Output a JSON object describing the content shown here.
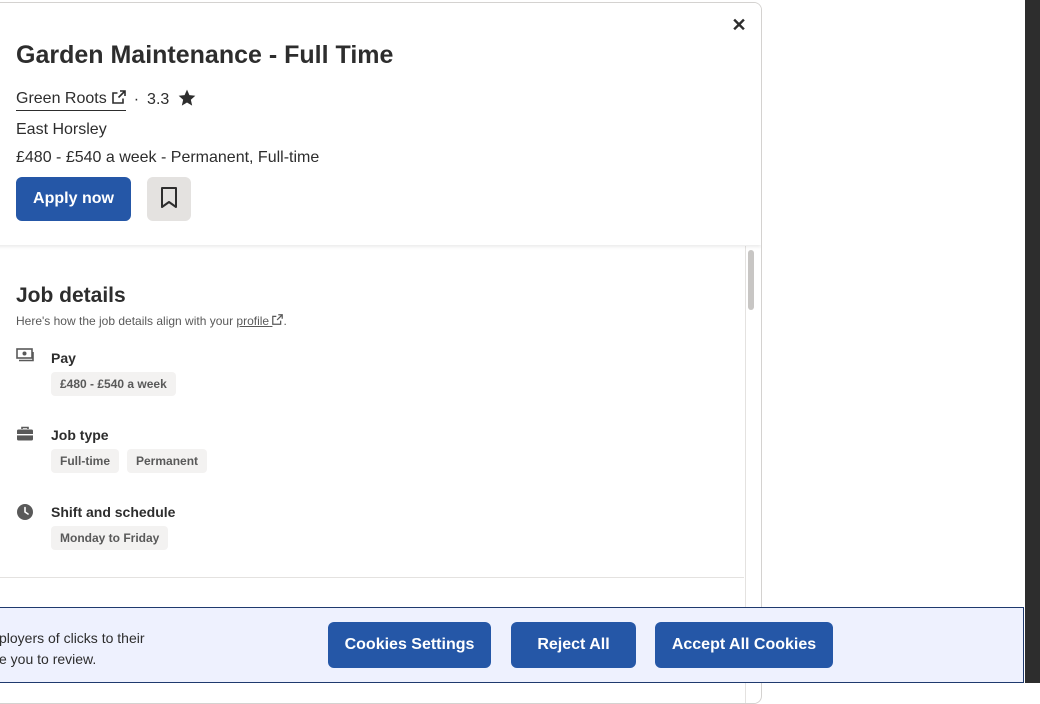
{
  "job": {
    "title": "Garden Maintenance - Full Time",
    "company": "Green Roots",
    "separator": "·",
    "rating": "3.3",
    "location": "East Horsley",
    "salary_line": "£480 - £540 a week  - Permanent, Full-time",
    "apply_label": "Apply now",
    "close_glyph": "✕"
  },
  "details": {
    "title": "Job details",
    "subtitle_prefix": "Here's how the job details align with your ",
    "subtitle_link": "profile",
    "subtitle_suffix": ".",
    "pay_label": "Pay",
    "pay_value": "£480 - £540 a week",
    "jobtype_label": "Job type",
    "jobtype_values": [
      "Full-time",
      "Permanent"
    ],
    "shift_label": "Shift and schedule",
    "shift_value": "Monday to Friday"
  },
  "cookies": {
    "text_line1": "ployers of clicks to their",
    "text_line2": "e you to review.",
    "settings_label": "Cookies Settings",
    "reject_label": "Reject All",
    "accept_label": "Accept All Cookies"
  },
  "icons": {
    "close": "close-icon",
    "external": "external-link-icon",
    "star": "star-icon",
    "bookmark": "bookmark-icon",
    "pay": "money-icon",
    "jobtype": "briefcase-icon",
    "shift": "clock-icon"
  },
  "colors": {
    "primary": "#2557a7",
    "text": "#2d2d2d",
    "chip_bg": "#f3f2f1",
    "banner_bg": "#eef1fe"
  }
}
